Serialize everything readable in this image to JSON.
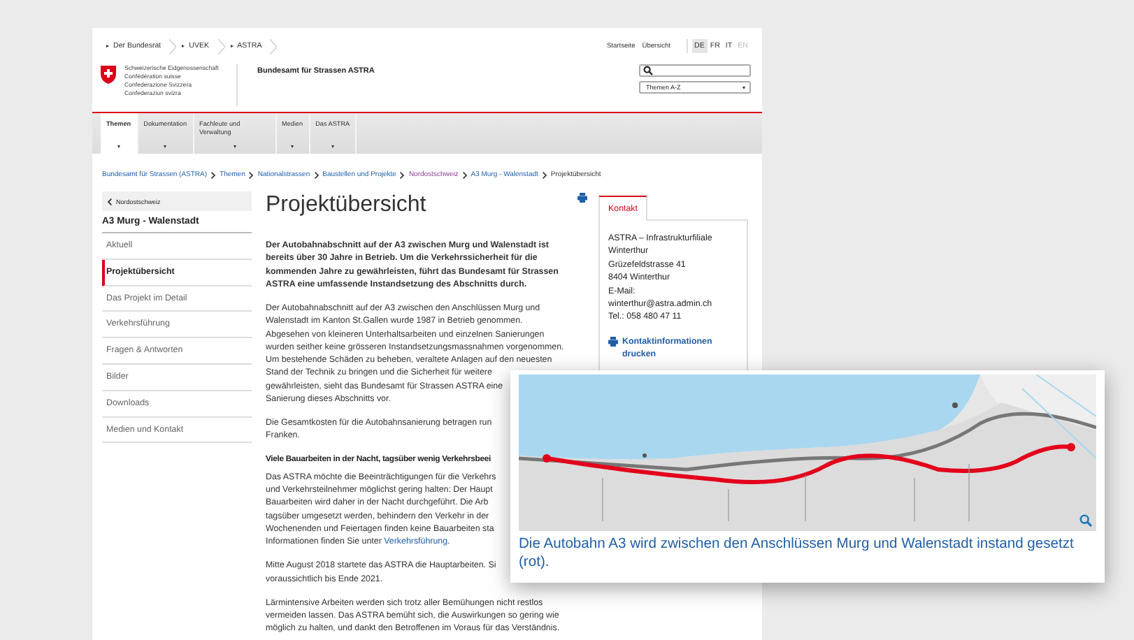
{
  "top_links": [
    "Der Bundesrat",
    "UVEK",
    "ASTRA"
  ],
  "service_links": [
    "Startseite",
    "Übersicht"
  ],
  "languages": [
    {
      "label": "DE",
      "selected": true,
      "disabled": false
    },
    {
      "label": "FR",
      "selected": false,
      "disabled": false
    },
    {
      "label": "IT",
      "selected": false,
      "disabled": false
    },
    {
      "label": "EN",
      "selected": false,
      "disabled": true
    }
  ],
  "logo": {
    "lines": [
      "Schweizerische Eidgenossenschaft",
      "Confédération suisse",
      "Confederazione Svizzera",
      "Confederaziun svizra"
    ],
    "office": "Bundesamt für Strassen ASTRA"
  },
  "topics_select": {
    "value": "Themen A-Z"
  },
  "nav_tabs": [
    {
      "label": "Themen",
      "selected": true
    },
    {
      "label": "Dokumentation",
      "selected": false
    },
    {
      "label": "Fachleute und Verwaltung",
      "selected": false
    },
    {
      "label": "Medien",
      "selected": false
    },
    {
      "label": "Das ASTRA",
      "selected": false
    }
  ],
  "breadcrumb": [
    {
      "label": "Bundesamt für Strassen (ASTRA)",
      "visited": false,
      "current": false
    },
    {
      "label": "Themen",
      "visited": false,
      "current": false
    },
    {
      "label": "Nationalstrassen",
      "visited": false,
      "current": false
    },
    {
      "label": "Baustellen und Projekte",
      "visited": false,
      "current": false
    },
    {
      "label": "Nordostschweiz",
      "visited": true,
      "current": false
    },
    {
      "label": "A3 Murg - Walenstadt",
      "visited": false,
      "current": false
    },
    {
      "label": "Projektübersicht",
      "visited": false,
      "current": true
    }
  ],
  "sidebar": {
    "back": "Nordostschweiz",
    "title": "A3 Murg - Walenstadt",
    "items": [
      {
        "label": "Aktuell",
        "selected": false
      },
      {
        "label": "Projektübersicht",
        "selected": true
      },
      {
        "label": "Das Projekt im Detail",
        "selected": false
      },
      {
        "label": "Verkehrsführung",
        "selected": false
      },
      {
        "label": "Fragen & Antworten",
        "selected": false
      },
      {
        "label": "Bilder",
        "selected": false
      },
      {
        "label": "Downloads",
        "selected": false
      },
      {
        "label": "Medien und Kontakt",
        "selected": false
      }
    ]
  },
  "article": {
    "title": "Projektübersicht",
    "blocks": [
      {
        "kind": "lead",
        "lines": [
          "Der Autobahnabschnitt auf der A3 zwischen Murg und Walenstadt ist",
          "bereits über 30 Jahre in Betrieb. Um die Verkehrssicherheit für die",
          "kommenden Jahre zu gewährleisten, führt das Bundesamt für Strassen",
          "ASTRA eine umfassende Instandsetzung des Abschnitts durch."
        ]
      },
      {
        "kind": "text",
        "lines": [
          "Der Autobahnabschnitt auf der A3 zwischen den Anschlüssen Murg und",
          "Walenstadt im Kanton St.Gallen wurde 1987 in Betrieb genommen.",
          "Abgesehen von kleineren Unterhaltsarbeiten und einzelnen Sanierungen",
          "wurden seither keine grösseren Instandsetzungsmassnahmen vorgenommen.",
          "Um bestehende Schäden zu beheben, veraltete Anlagen auf den neuesten",
          "Stand der Technik zu bringen und die Sicherheit für weitere",
          "gewährleisten, sieht das Bundesamt für Strassen ASTRA eine",
          "Sanierung dieses Abschnitts vor."
        ]
      },
      {
        "kind": "text",
        "lines": [
          "Die Gesamtkosten für die Autobahnsanierung betragen run",
          "Franken."
        ]
      },
      {
        "kind": "heading",
        "lines": [
          "Viele Bauarbeiten in der Nacht, tagsüber wenig Verkehrsbeei"
        ]
      },
      {
        "kind": "text",
        "lines": [
          "Das ASTRA möchte die Beeinträchtigungen für die Verkehrs",
          "und Verkehrsteilnehmer möglichst gering halten: Der Haupt",
          "Bauarbeiten wird daher in der Nacht durchgeführt. Die Arb",
          "tagsüber umgesetzt werden, behindern den Verkehr in der",
          "Wochenenden und Feiertagen finden keine Bauarbeiten sta",
          [
            {
              "text": "Informationen finden Sie unter "
            },
            {
              "text": "Verkehrsführung",
              "kind": "link"
            },
            {
              "text": "."
            }
          ]
        ]
      },
      {
        "kind": "text",
        "lines": [
          "Mitte August 2018 startete das ASTRA die Hauptarbeiten. Si",
          "voraussichtlich bis Ende 2021."
        ]
      },
      {
        "kind": "text",
        "lines": [
          "Lärmintensive Arbeiten werden sich trotz aller Bemühungen nicht restlos",
          "vermeiden lassen. Das ASTRA bemüht sich, die Auswirkungen so gering wie",
          "möglich zu halten, und dankt den Betroffenen im Voraus für das Verständnis."
        ]
      }
    ]
  },
  "contact": {
    "tab": "Kontakt",
    "lines": [
      "ASTRA – Infrastrukturfiliale Winterthur",
      "Grüzefeldstrasse 41",
      "8404 Winterthur",
      "E-Mail:",
      "winterthur@astra.admin.ch",
      "Tel.: 058 480 47 11"
    ],
    "print_link": "Kontaktinformationen drucken"
  },
  "figure": {
    "kind": "picture",
    "caption": "Die Autobahn A3 wird zwischen den Anschlüssen Murg und Walenstadt instand gesetzt (rot)."
  }
}
